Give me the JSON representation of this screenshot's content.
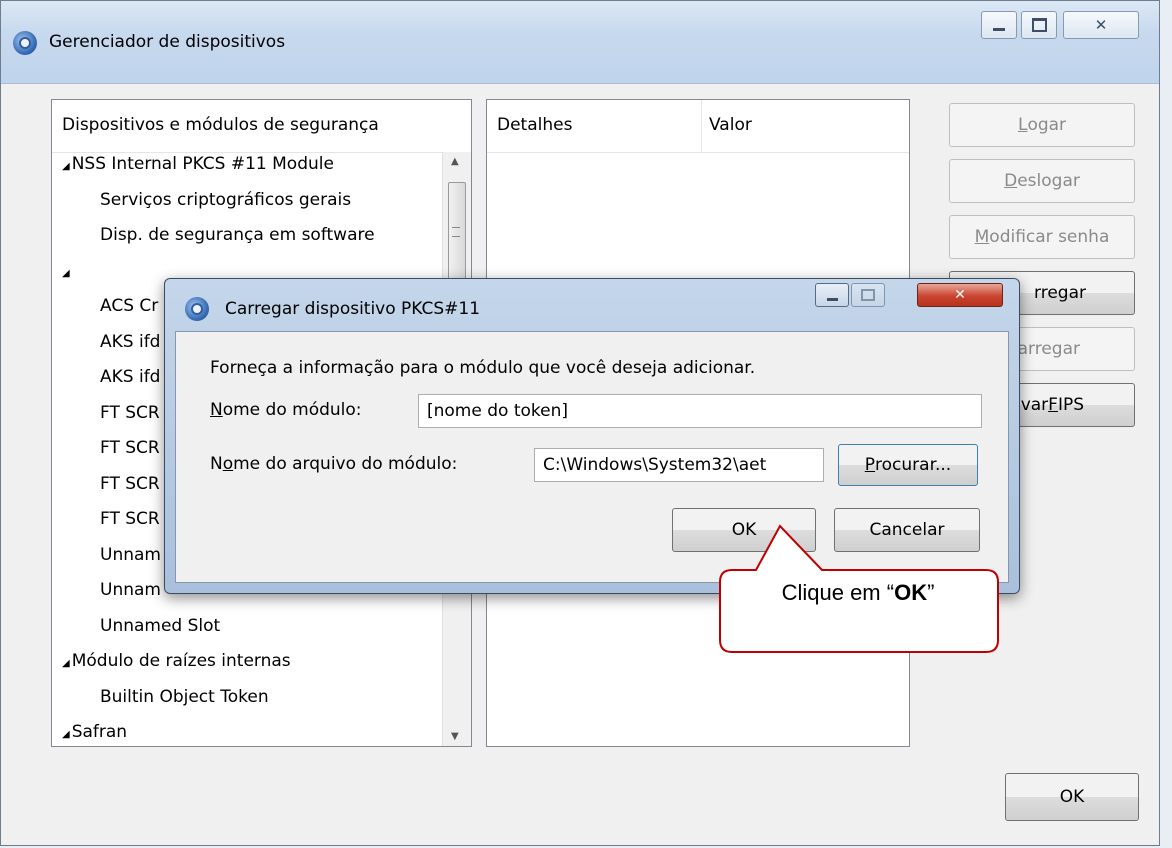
{
  "main_window": {
    "title": "Gerenciador de dispositivos",
    "tree_header": "Dispositivos e módulos de segurança",
    "details_header": "Detalhes",
    "value_header": "Valor",
    "tree": [
      {
        "label": "NSS Internal PKCS #11 Module",
        "expander": true
      },
      {
        "label": "Serviços criptográficos gerais",
        "expander": false
      },
      {
        "label": "Disp. de segurança em software",
        "expander": false
      },
      {
        "label": "",
        "expander": true
      },
      {
        "label": "ACS Cr",
        "expander": false
      },
      {
        "label": "AKS ifd",
        "expander": false
      },
      {
        "label": "AKS ifd",
        "expander": false
      },
      {
        "label": "FT SCR",
        "expander": false
      },
      {
        "label": "FT SCR",
        "expander": false
      },
      {
        "label": "FT SCR",
        "expander": false
      },
      {
        "label": "FT SCR",
        "expander": false
      },
      {
        "label": "Unnam",
        "expander": false
      },
      {
        "label": "Unnam",
        "expander": false
      },
      {
        "label": "Unnamed Slot",
        "expander": false
      },
      {
        "label": "Módulo de raízes internas",
        "expander": true
      },
      {
        "label": "Builtin Object Token",
        "expander": false
      },
      {
        "label": "Safran",
        "expander": true
      }
    ],
    "buttons": {
      "logar_u": "L",
      "logar_rest": "ogar",
      "deslogar_u": "D",
      "deslogar_rest": "eslogar",
      "modificar_u": "M",
      "modificar_rest": "odificar senha",
      "carregar": "rregar",
      "descarregar": "carregar",
      "fips_pre": "var ",
      "fips_u": "F",
      "fips_rest": "IPS",
      "ok": "OK"
    }
  },
  "dialog": {
    "title": "Carregar dispositivo PKCS#11",
    "instruction": "Forneça a informação para o módulo que você deseja adicionar.",
    "module_name_label_u": "N",
    "module_name_label_rest": "ome do módulo:",
    "module_name_value": "[nome do token]",
    "module_file_label_pre": "N",
    "module_file_label_u": "o",
    "module_file_label_rest": "me do arquivo do módulo:",
    "module_file_value": "C:\\Windows\\System32\\aet",
    "browse_u": "P",
    "browse_rest": "rocurar...",
    "ok_label": "OK",
    "cancel_label": "Cancelar"
  },
  "callout": {
    "prefix": "Clique em “",
    "bold": "OK",
    "suffix": "”",
    "fill": "#ffffff",
    "stroke": "#c00000"
  }
}
